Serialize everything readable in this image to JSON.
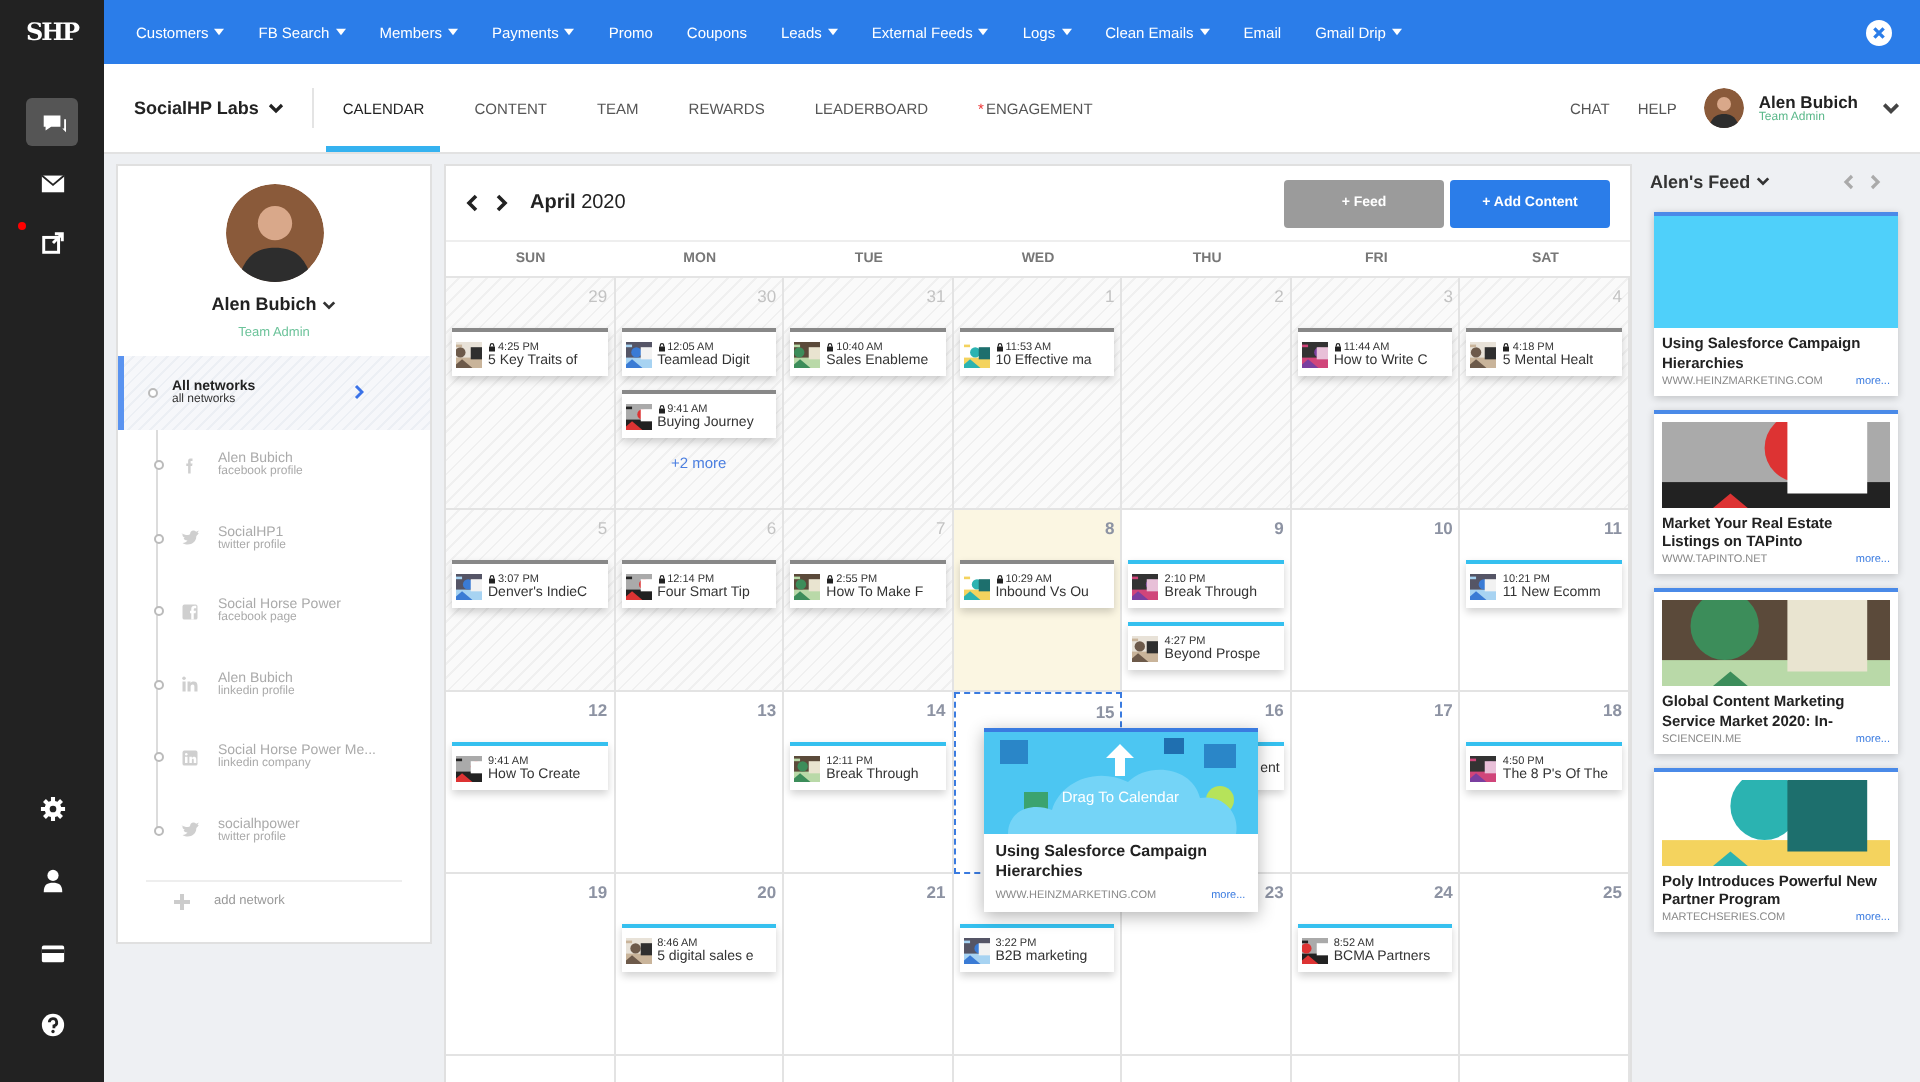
{
  "sidebar": {
    "logo": "SHP",
    "top": [
      {
        "kind": "chat",
        "selected": true,
        "alert": false
      },
      {
        "kind": "mail",
        "selected": false,
        "alert": false
      },
      {
        "kind": "share",
        "selected": false,
        "alert": true
      }
    ],
    "bottom": [
      {
        "kind": "settings",
        "selected": false,
        "alert": false
      },
      {
        "kind": "user",
        "selected": false,
        "alert": false
      },
      {
        "kind": "card",
        "selected": false,
        "alert": false
      },
      {
        "kind": "help",
        "selected": false,
        "alert": false
      }
    ]
  },
  "top_nav": [
    {
      "label": "Customers",
      "dropdown": true
    },
    {
      "label": "FB Search",
      "dropdown": true
    },
    {
      "label": "Members",
      "dropdown": true
    },
    {
      "label": "Payments",
      "dropdown": true
    },
    {
      "label": "Promo",
      "dropdown": false
    },
    {
      "label": "Coupons",
      "dropdown": false
    },
    {
      "label": "Leads",
      "dropdown": true
    },
    {
      "label": "External Feeds",
      "dropdown": true
    },
    {
      "label": "Logs",
      "dropdown": true
    },
    {
      "label": "Clean Emails",
      "dropdown": true
    },
    {
      "label": "Email",
      "dropdown": false
    },
    {
      "label": "Gmail Drip",
      "dropdown": true
    }
  ],
  "workspace": "SocialHP Labs",
  "tabs": [
    {
      "label": "CALENDAR",
      "selected": true
    },
    {
      "label": "CONTENT",
      "selected": false
    },
    {
      "label": "TEAM",
      "selected": false
    },
    {
      "label": "REWARDS",
      "selected": false
    },
    {
      "label": "LEADERBOARD",
      "selected": false
    },
    {
      "label": "ENGAGEMENT",
      "selected": false,
      "marker": "*"
    }
  ],
  "header_links": [
    "CHAT",
    "HELP"
  ],
  "user": {
    "name": "Alen Bubich",
    "role": "Team Admin"
  },
  "profile": {
    "name": "Alen Bubich",
    "role": "Team Admin",
    "networks": [
      {
        "kind": "all",
        "name": "All networks",
        "type": "all networks",
        "selected": true
      },
      {
        "kind": "facebook",
        "name": "Alen Bubich",
        "type": "facebook profile",
        "selected": false
      },
      {
        "kind": "twitter",
        "name": "SocialHP1",
        "type": "twitter profile",
        "selected": false
      },
      {
        "kind": "facebook-page",
        "name": "Social Horse Power",
        "type": "facebook page",
        "selected": false
      },
      {
        "kind": "linkedin",
        "name": "Alen Bubich",
        "type": "linkedin profile",
        "selected": false
      },
      {
        "kind": "linkedin-company",
        "name": "Social Horse Power Me...",
        "type": "linkedin company",
        "selected": false
      },
      {
        "kind": "twitter",
        "name": "socialhpower",
        "type": "twitter profile",
        "selected": false
      }
    ],
    "add_label": "add network"
  },
  "calendar": {
    "month": "April",
    "year": "2020",
    "buttons": [
      {
        "label": "+ Feed",
        "kind": "secondary"
      },
      {
        "label": "+ Add Content",
        "kind": "primary"
      }
    ],
    "weekdays": [
      "SUN",
      "MON",
      "TUE",
      "WED",
      "THU",
      "FRI",
      "SAT"
    ],
    "weeks": [
      {
        "days": [
          {
            "day": "29",
            "kind": "other",
            "posts": [
              {
                "time": "4:25 PM",
                "title": "5 Key Traits of",
                "locked": true
              }
            ]
          },
          {
            "day": "30",
            "kind": "other",
            "posts": [
              {
                "time": "12:05 AM",
                "title": "Teamlead Digit",
                "locked": true
              },
              {
                "time": "9:41 AM",
                "title": "Buying Journey",
                "locked": true
              }
            ],
            "more": "+2 more"
          },
          {
            "day": "31",
            "kind": "other",
            "posts": [
              {
                "time": "10:40 AM",
                "title": "Sales Enableme",
                "locked": true
              }
            ]
          },
          {
            "day": "1",
            "kind": "past",
            "posts": [
              {
                "time": "11:53 AM",
                "title": "10 Effective ma",
                "locked": true
              }
            ]
          },
          {
            "day": "2",
            "kind": "past"
          },
          {
            "day": "3",
            "kind": "past",
            "posts": [
              {
                "time": "11:44 AM",
                "title": "How to Write C",
                "locked": true
              }
            ]
          },
          {
            "day": "4",
            "kind": "past",
            "posts": [
              {
                "time": "4:18 PM",
                "title": "5 Mental Healt",
                "locked": true
              }
            ]
          }
        ]
      },
      {
        "days": [
          {
            "day": "5",
            "kind": "past",
            "posts": [
              {
                "time": "3:07 PM",
                "title": "Denver's IndieC",
                "locked": true
              }
            ]
          },
          {
            "day": "6",
            "kind": "past",
            "posts": [
              {
                "time": "12:14 PM",
                "title": "Four Smart Tip",
                "locked": true
              }
            ]
          },
          {
            "day": "7",
            "kind": "past",
            "posts": [
              {
                "time": "2:55 PM",
                "title": "How To Make F",
                "locked": true
              }
            ]
          },
          {
            "day": "8",
            "kind": "today",
            "posts": [
              {
                "time": "10:29 AM",
                "title": "Inbound Vs Ou",
                "locked": true
              }
            ]
          },
          {
            "day": "9",
            "kind": "normal",
            "posts": [
              {
                "time": "2:10 PM",
                "title": "Break Through",
                "locked": false
              },
              {
                "time": "4:27 PM",
                "title": "Beyond Prospe",
                "locked": false
              }
            ]
          },
          {
            "day": "10",
            "kind": "normal"
          },
          {
            "day": "11",
            "kind": "normal",
            "posts": [
              {
                "time": "10:21 PM",
                "title": "11 New Ecomm",
                "locked": false
              }
            ]
          }
        ]
      },
      {
        "days": [
          {
            "day": "12",
            "kind": "normal",
            "posts": [
              {
                "time": "9:41 AM",
                "title": "How To Create",
                "locked": false
              }
            ]
          },
          {
            "day": "13",
            "kind": "normal"
          },
          {
            "day": "14",
            "kind": "normal",
            "posts": [
              {
                "time": "12:11 PM",
                "title": "Break Through",
                "locked": false
              }
            ]
          },
          {
            "day": "15",
            "kind": "drop"
          },
          {
            "day": "16",
            "kind": "normal",
            "posts": [
              {
                "title": "ent",
                "locked": false,
                "covered": true
              }
            ]
          },
          {
            "day": "17",
            "kind": "normal"
          },
          {
            "day": "18",
            "kind": "normal",
            "posts": [
              {
                "time": "4:50 PM",
                "title": "The 8 P's Of The",
                "locked": false
              }
            ]
          }
        ]
      },
      {
        "days": [
          {
            "day": "19",
            "kind": "normal"
          },
          {
            "day": "20",
            "kind": "normal",
            "posts": [
              {
                "time": "8:46 AM",
                "title": "5 digital sales e",
                "locked": false
              }
            ]
          },
          {
            "day": "21",
            "kind": "normal"
          },
          {
            "kind": "normal",
            "posts": [
              {
                "time": "3:22 PM",
                "title": "B2B marketing",
                "locked": false
              }
            ]
          },
          {
            "day": "23",
            "kind": "normal"
          },
          {
            "day": "24",
            "kind": "normal",
            "posts": [
              {
                "time": "8:52 AM",
                "title": "BCMA Partners",
                "locked": false
              }
            ]
          },
          {
            "day": "25",
            "kind": "normal"
          }
        ]
      },
      {
        "days": [
          {
            "kind": "normal"
          },
          {
            "kind": "normal"
          },
          {
            "kind": "normal"
          },
          {
            "kind": "normal"
          },
          {
            "kind": "normal"
          },
          {
            "kind": "normal"
          },
          {
            "kind": "normal"
          }
        ]
      }
    ],
    "drag_card": {
      "hint": "Drag To Calendar",
      "title": "Using Salesforce Campaign Hierarchies",
      "domain": "WWW.HEINZMARKETING.COM",
      "more": "more..."
    }
  },
  "feed": {
    "title": "Alen's Feed",
    "items": [
      {
        "kind": "blank",
        "title": "Using Salesforce Campaign Hierarchies",
        "domain": "WWW.HEINZMARKETING.COM",
        "more": "more..."
      },
      {
        "kind": "picture",
        "title": "Market Your Real Estate Listings on TAPinto",
        "domain": "WWW.TAPINTO.NET",
        "more": "more..."
      },
      {
        "kind": "picture",
        "title": "Global Content Marketing Service Market 2020: In-",
        "domain": "SCIENCEIN.ME",
        "more": "more..."
      },
      {
        "kind": "picture",
        "title": "Poly Introduces Powerful New Partner Program",
        "domain": "MARTECHSERIES.COM",
        "more": "more..."
      }
    ]
  }
}
